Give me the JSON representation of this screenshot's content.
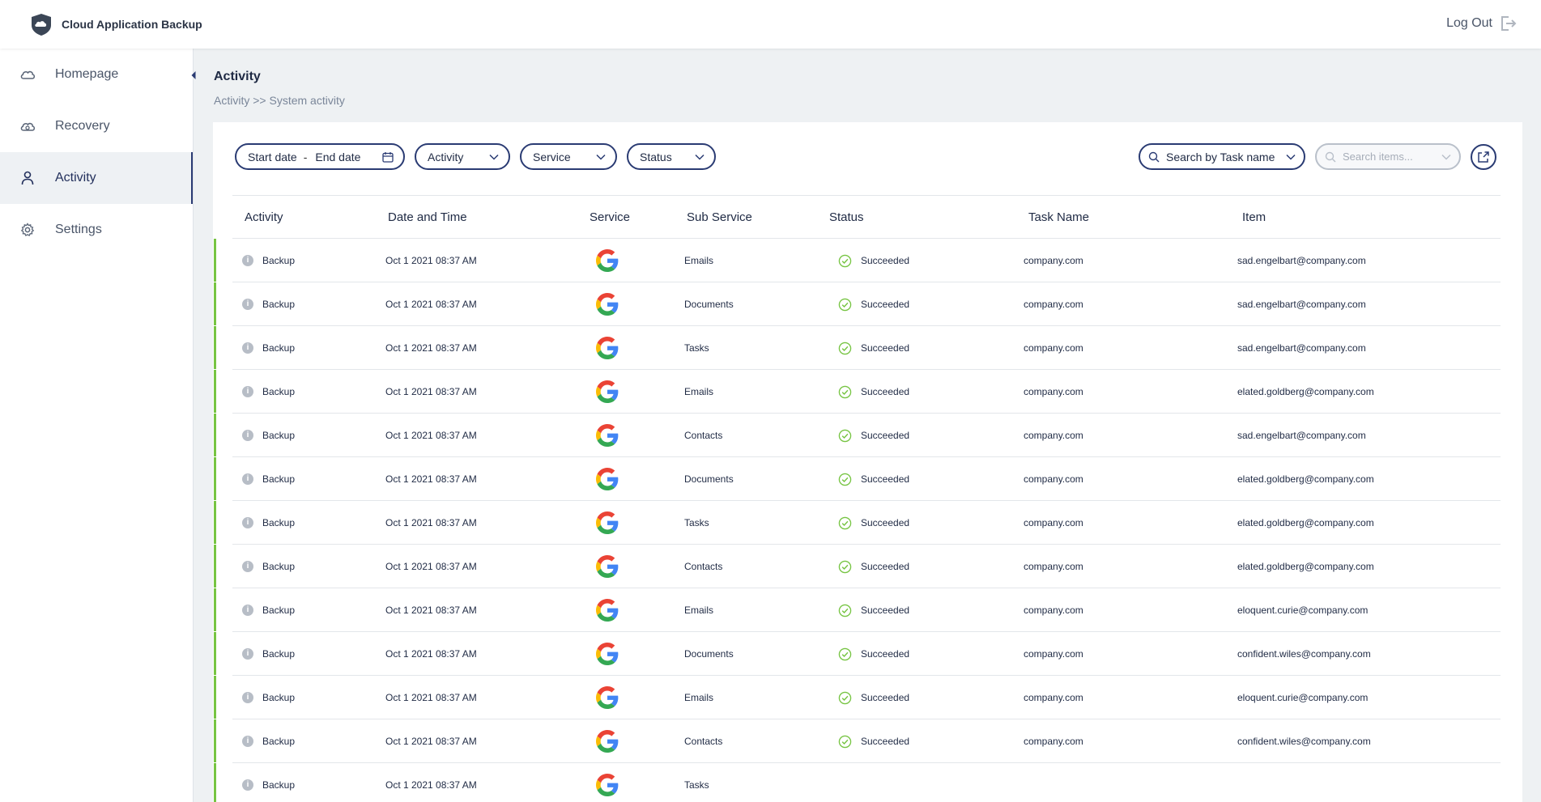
{
  "app": {
    "name": "Cloud Application Backup"
  },
  "header": {
    "logout_label": "Log Out"
  },
  "sidebar": {
    "items": [
      {
        "label": "Homepage",
        "icon": "cloud-icon",
        "active": false
      },
      {
        "label": "Recovery",
        "icon": "cloud-sync-icon",
        "active": false
      },
      {
        "label": "Activity",
        "icon": "user-icon",
        "active": true
      },
      {
        "label": "Settings",
        "icon": "gear-icon",
        "active": false
      }
    ]
  },
  "page": {
    "title": "Activity",
    "breadcrumb": {
      "first": "Activity",
      "separator": ">>",
      "second": "System activity"
    }
  },
  "filters": {
    "start_date": "Start date",
    "dash": "-",
    "end_date": "End date",
    "activity": "Activity",
    "service": "Service",
    "status": "Status"
  },
  "search": {
    "task_select": "Search by Task name",
    "items_placeholder": "Search items..."
  },
  "table": {
    "columns": [
      "Activity",
      "Date and Time",
      "Service",
      "Sub Service",
      "Status",
      "Task Name",
      "Item"
    ],
    "rows": [
      {
        "activity": "Backup",
        "date": "Oct 1 2021 08:37 AM",
        "service": "google-icon",
        "sub": "Emails",
        "status": "Succeeded",
        "task": "company.com",
        "item": "sad.engelbart@company.com"
      },
      {
        "activity": "Backup",
        "date": "Oct 1 2021 08:37 AM",
        "service": "google-icon",
        "sub": "Documents",
        "status": "Succeeded",
        "task": "company.com",
        "item": "sad.engelbart@company.com"
      },
      {
        "activity": "Backup",
        "date": "Oct 1 2021 08:37 AM",
        "service": "google-icon",
        "sub": "Tasks",
        "status": "Succeeded",
        "task": "company.com",
        "item": "sad.engelbart@company.com"
      },
      {
        "activity": "Backup",
        "date": "Oct 1 2021 08:37 AM",
        "service": "google-icon",
        "sub": "Emails",
        "status": "Succeeded",
        "task": "company.com",
        "item": "elated.goldberg@company.com"
      },
      {
        "activity": "Backup",
        "date": "Oct 1 2021 08:37 AM",
        "service": "google-icon",
        "sub": "Contacts",
        "status": "Succeeded",
        "task": "company.com",
        "item": "sad.engelbart@company.com"
      },
      {
        "activity": "Backup",
        "date": "Oct 1 2021 08:37 AM",
        "service": "google-icon",
        "sub": "Documents",
        "status": "Succeeded",
        "task": "company.com",
        "item": "elated.goldberg@company.com"
      },
      {
        "activity": "Backup",
        "date": "Oct 1 2021 08:37 AM",
        "service": "google-icon",
        "sub": "Tasks",
        "status": "Succeeded",
        "task": "company.com",
        "item": "elated.goldberg@company.com"
      },
      {
        "activity": "Backup",
        "date": "Oct 1 2021 08:37 AM",
        "service": "google-icon",
        "sub": "Contacts",
        "status": "Succeeded",
        "task": "company.com",
        "item": "elated.goldberg@company.com"
      },
      {
        "activity": "Backup",
        "date": "Oct 1 2021 08:37 AM",
        "service": "google-icon",
        "sub": "Emails",
        "status": "Succeeded",
        "task": "company.com",
        "item": "eloquent.curie@company.com"
      },
      {
        "activity": "Backup",
        "date": "Oct 1 2021 08:37 AM",
        "service": "google-icon",
        "sub": "Documents",
        "status": "Succeeded",
        "task": "company.com",
        "item": "confident.wiles@company.com"
      },
      {
        "activity": "Backup",
        "date": "Oct 1 2021 08:37 AM",
        "service": "google-icon",
        "sub": "Emails",
        "status": "Succeeded",
        "task": "company.com",
        "item": "eloquent.curie@company.com"
      },
      {
        "activity": "Backup",
        "date": "Oct 1 2021 08:37 AM",
        "service": "google-icon",
        "sub": "Contacts",
        "status": "Succeeded",
        "task": "company.com",
        "item": "confident.wiles@company.com"
      },
      {
        "activity": "Backup",
        "date": "Oct 1 2021 08:37 AM",
        "service": "google-icon",
        "sub": "Tasks",
        "status": "",
        "task": "",
        "item": ""
      }
    ]
  },
  "colors": {
    "accent": "#2a3b73",
    "success": "#76c442",
    "google_blue": "#4285F4",
    "google_red": "#EA4335",
    "google_yellow": "#FBBC05",
    "google_green": "#34A853"
  }
}
